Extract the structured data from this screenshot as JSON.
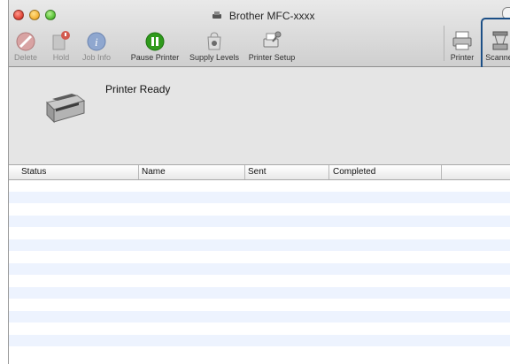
{
  "window": {
    "title": "Brother MFC-xxxx"
  },
  "toolbar": {
    "items": [
      {
        "label": "Delete",
        "icon": "delete-icon",
        "enabled": false
      },
      {
        "label": "Hold",
        "icon": "hold-icon",
        "enabled": false
      },
      {
        "label": "Job Info",
        "icon": "info-icon",
        "enabled": false
      },
      {
        "label": "Pause Printer",
        "icon": "pause-icon",
        "enabled": true
      },
      {
        "label": "Supply Levels",
        "icon": "supply-levels-icon",
        "enabled": true
      },
      {
        "label": "Printer Setup",
        "icon": "printer-setup-icon",
        "enabled": true
      },
      {
        "label": "Printer",
        "icon": "printer-icon",
        "enabled": true
      },
      {
        "label": "Scanner",
        "icon": "scanner-icon",
        "enabled": true
      }
    ]
  },
  "status": {
    "text": "Printer Ready"
  },
  "jobs_table": {
    "columns": [
      "Status",
      "Name",
      "Sent",
      "Completed"
    ],
    "rows": []
  },
  "colors": {
    "row_alt": "#edf3fe",
    "highlight": "#1c4f86",
    "pause_green": "#2f9a1c"
  }
}
